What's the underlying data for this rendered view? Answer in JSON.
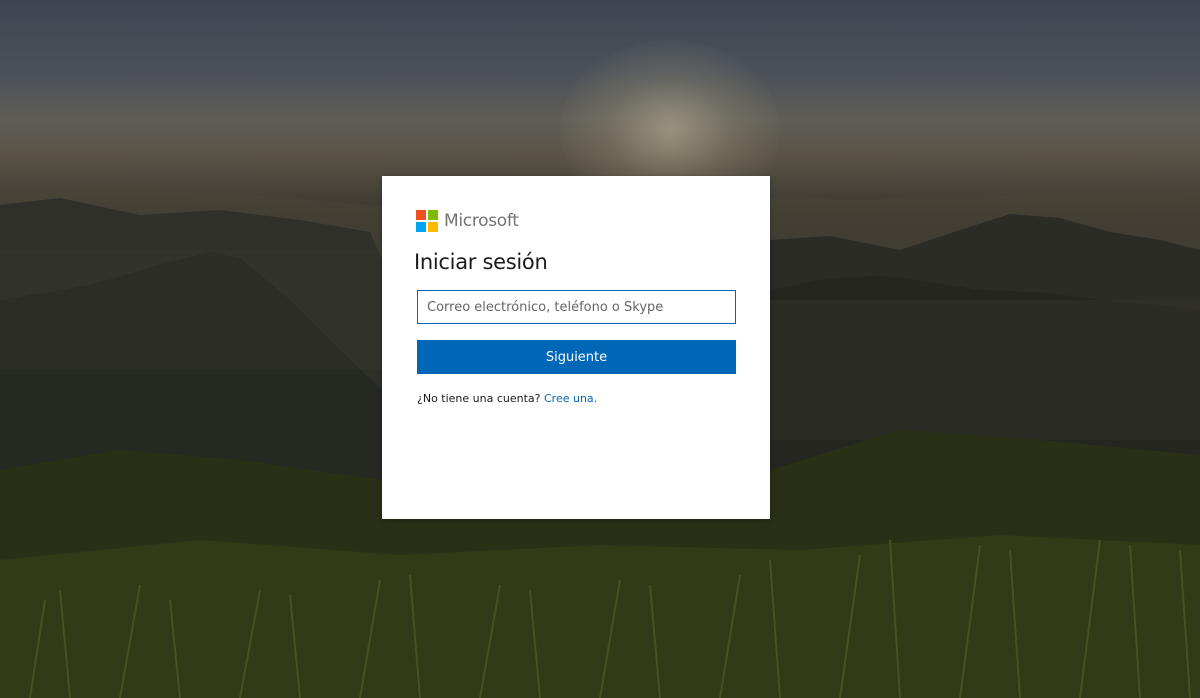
{
  "brand": {
    "name": "Microsoft",
    "logo_colors": [
      "#f25022",
      "#7fba00",
      "#00a4ef",
      "#ffb900"
    ],
    "text_color": "#737373"
  },
  "signin": {
    "title": "Iniciar sesión",
    "email_placeholder": "Correo electrónico, teléfono o Skype",
    "email_value": "",
    "next_label": "Siguiente",
    "no_account_text": "¿No tiene una cuenta?",
    "create_link": "Cree una."
  },
  "colors": {
    "accent": "#0067b8",
    "card_background": "#ffffff"
  },
  "background": {
    "scene": "sunset-over-mountains-and-grass"
  }
}
